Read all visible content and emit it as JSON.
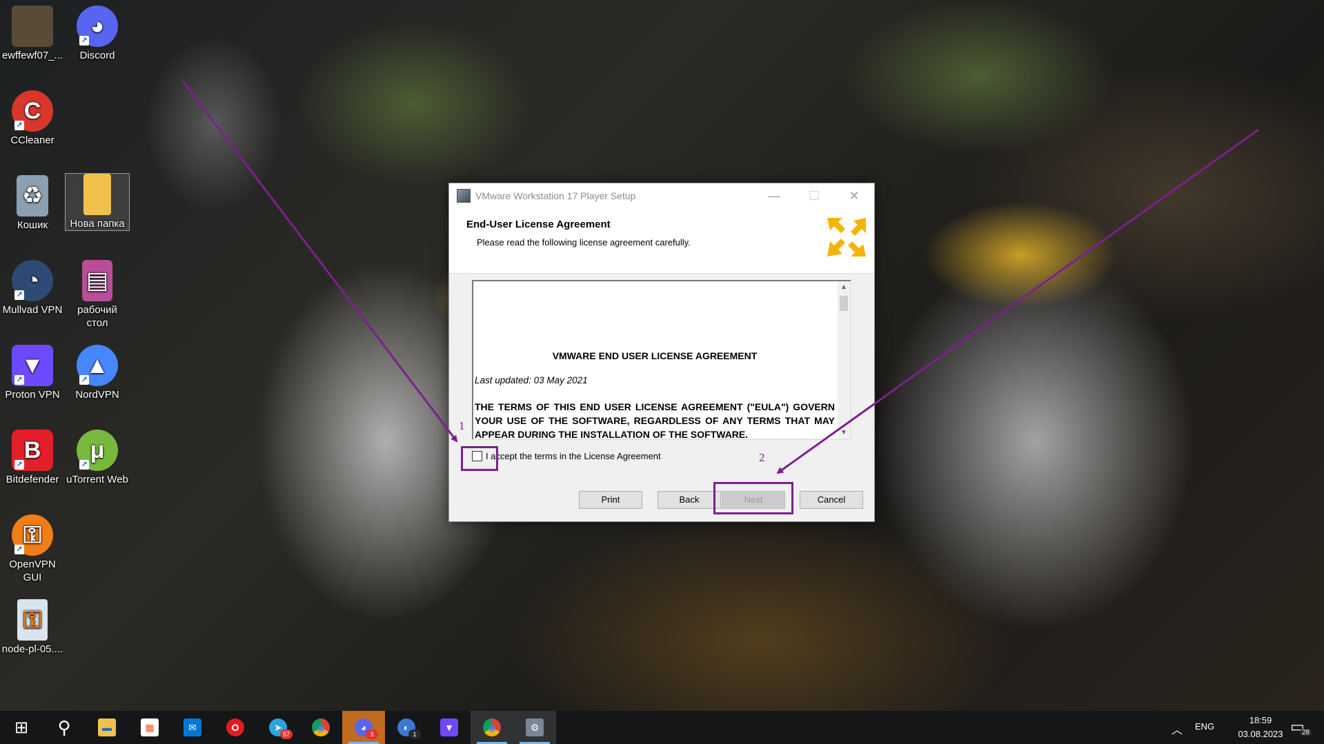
{
  "desktop": {
    "icons": [
      {
        "label": "ewffewf07_...",
        "color": "#5a4a38"
      },
      {
        "label": "Discord",
        "color": "#5865f2"
      },
      {
        "label": "CCleaner",
        "color": "#d9372b"
      },
      {
        "label": "Кошик",
        "color": "#8aa1b1"
      },
      {
        "label": "Нова папка",
        "color": "#f0c24b"
      },
      {
        "label": "Mullvad VPN",
        "color": "#2d4a74"
      },
      {
        "label": "рабочий стол",
        "color": "#b84d9a"
      },
      {
        "label": "Proton VPN",
        "color": "#6d4aff"
      },
      {
        "label": "NordVPN",
        "color": "#4687ff"
      },
      {
        "label": "Bitdefender",
        "color": "#e3202a"
      },
      {
        "label": "uTorrent Web",
        "color": "#78b83c"
      },
      {
        "label": "OpenVPN GUI",
        "color": "#f07d16"
      },
      {
        "label": "node-pl-05....",
        "color": "#d8e4ee"
      }
    ]
  },
  "dialog": {
    "title": "VMware Workstation 17 Player Setup",
    "minimize_glyph": "—",
    "maximize_glyph": "☐",
    "close_glyph": "✕",
    "header_title": "End-User License Agreement",
    "header_subtitle": "Please read the following license agreement carefully.",
    "eula": {
      "heading": "VMWARE END USER LICENSE AGREEMENT",
      "updated": "Last updated: 03 May 2021",
      "paragraph": "THE TERMS OF THIS END USER LICENSE AGREEMENT (\"EULA\") GOVERN YOUR USE OF THE SOFTWARE, REGARDLESS OF ANY TERMS THAT MAY APPEAR DURING THE INSTALLATION OF THE SOFTWARE."
    },
    "accept_label": "I accept the terms in the License Agreement",
    "accept_checked": false,
    "buttons": {
      "print": "Print",
      "back": "Back",
      "next": "Next",
      "cancel": "Cancel"
    },
    "next_enabled": false
  },
  "annotations": {
    "color": "#7d1f8f",
    "label_1": "1",
    "label_2": "2"
  },
  "taskbar": {
    "apps": [
      {
        "name": "start",
        "glyph": "⊞"
      },
      {
        "name": "search",
        "glyph": "⚲"
      },
      {
        "name": "file-explorer",
        "glyph": "▬"
      },
      {
        "name": "microsoft-store",
        "glyph": "▦"
      },
      {
        "name": "mail",
        "glyph": "✉"
      },
      {
        "name": "opera",
        "glyph": "O"
      },
      {
        "name": "telegram",
        "glyph": "➤",
        "badge": "57"
      },
      {
        "name": "chrome",
        "glyph": "◉"
      },
      {
        "name": "discord",
        "glyph": "◕",
        "badge": "3"
      },
      {
        "name": "app-1",
        "glyph": "◐",
        "badge": "1"
      },
      {
        "name": "proton-vpn",
        "glyph": "▼"
      },
      {
        "name": "chrome-2",
        "glyph": "◉"
      },
      {
        "name": "setup",
        "glyph": "⚙"
      }
    ],
    "language": "ENG",
    "time": "18:59",
    "date": "03.08.2023",
    "notification_count": "28"
  }
}
